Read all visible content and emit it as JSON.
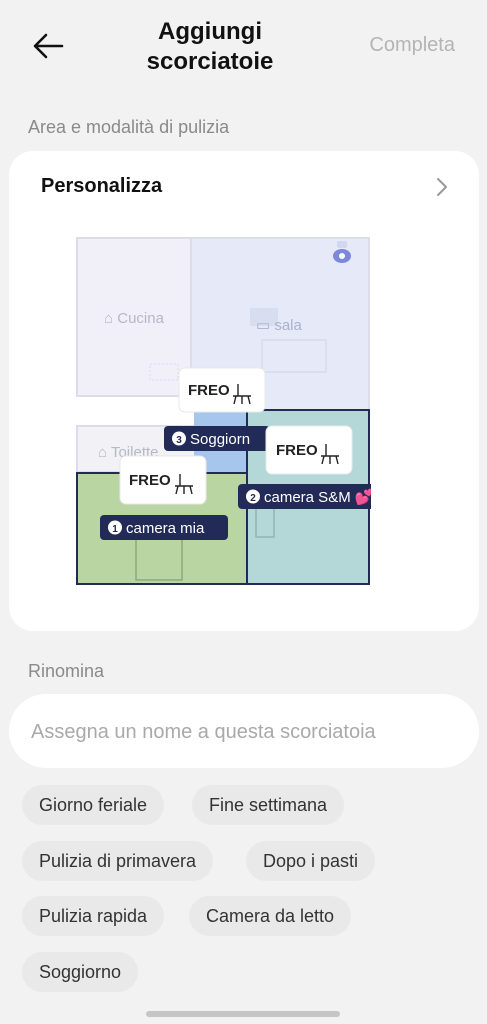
{
  "header": {
    "title_line1": "Aggiungi",
    "title_line2": "scorciatoie",
    "done_label": "Completa"
  },
  "area_section": {
    "label": "Area e modalità di pulizia",
    "card_title": "Personalizza",
    "rooms": [
      {
        "name": "Cucina",
        "icon": "chef-hat-icon"
      },
      {
        "name": "sala",
        "icon": "sofa-icon"
      },
      {
        "name": "Toilette",
        "icon": "toilet-icon"
      }
    ],
    "selected": [
      {
        "order": "1",
        "name": "camera mia",
        "mode": "FREO"
      },
      {
        "order": "2",
        "name": "camera S&M",
        "mode": "FREO",
        "emoji": "💕"
      },
      {
        "order": "3",
        "name": "Soggiorn",
        "mode": "FREO"
      }
    ]
  },
  "rename": {
    "label": "Rinomina",
    "placeholder": "Assegna un nome a questa scorciatoia",
    "value": "",
    "suggestions": [
      "Giorno feriale",
      "Fine settimana",
      "Pulizia di primavera",
      "Dopo i pasti",
      "Pulizia rapida",
      "Camera da letto",
      "Soggiorno"
    ]
  },
  "colors": {
    "accent_dark": "#222b57",
    "room_green": "#b9d6a2",
    "room_teal": "#b4d8d7",
    "room_blue": "#a7c6ee"
  }
}
